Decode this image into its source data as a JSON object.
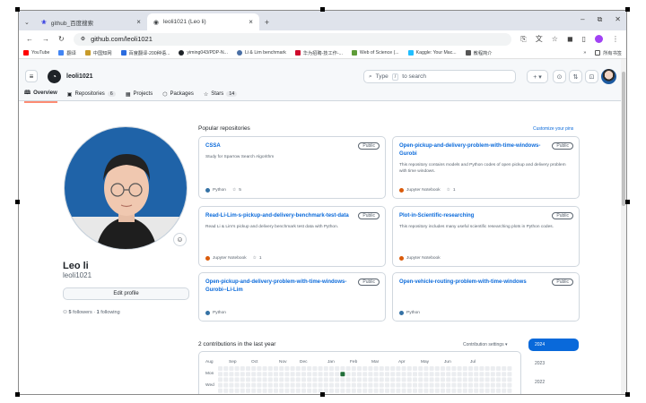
{
  "browser": {
    "tabs": [
      {
        "label": "github_百度搜索",
        "active": false
      },
      {
        "label": "leoli1021 (Leo li)",
        "active": true
      }
    ],
    "url": "github.com/leoli1021",
    "bookmarks": [
      "YouTube",
      "翻译",
      "中国知网",
      "百度翻译-200种语...",
      "yiming043/PDP-N...",
      "Li & Lim benchmark",
      "华为招聘-技工作-...",
      "Web of Science (...",
      "Kaggle: Your Mac...",
      "教程简介"
    ],
    "bookmarks_more": "»",
    "all_bookmarks": "所有书签"
  },
  "header": {
    "username": "leoli1021",
    "search_placeholder": "Type / to search",
    "search_key": "/",
    "search_prefix": "Type",
    "search_suffix": "to search"
  },
  "nav": {
    "overview": "Overview",
    "repositories": "Repositories",
    "repositories_count": "6",
    "projects": "Projects",
    "packages": "Packages",
    "stars": "Stars",
    "stars_count": "14"
  },
  "profile": {
    "name": "Leo li",
    "login": "leoli1021",
    "edit_label": "Edit profile",
    "followers": "5",
    "followers_label": "followers",
    "following": "1",
    "following_label": "following"
  },
  "popular": {
    "title": "Popular repositories",
    "customize": "Customize your pins",
    "repos": [
      {
        "name": "CSSA",
        "badge": "Public",
        "desc": "Study for Sparrow Search Algorithm",
        "lang": "Python",
        "color": "#3572A5",
        "stars": "5"
      },
      {
        "name": "Open-pickup-and-delivery-problem-with-time-windows-Gurobi",
        "badge": "Public",
        "desc": "This repository contains models and Python codes of open pickup and delivery problem with time windows.",
        "lang": "Jupyter Notebook",
        "color": "#DA5B0B",
        "stars": "1"
      },
      {
        "name": "Read-Li-Lim-s-pickup-and-delivery-benchmark-test-data",
        "badge": "Public",
        "desc": "Read Li & Lim's pickup and delivery benchmark test data with Python.",
        "lang": "Jupyter Notebook",
        "color": "#DA5B0B",
        "stars": "1"
      },
      {
        "name": "Plot-in-Scientific-researching",
        "badge": "Public",
        "desc": "This repository includes many useful scientific researching plots in Python codes.",
        "lang": "Jupyter Notebook",
        "color": "#DA5B0B",
        "stars": ""
      },
      {
        "name": "Open-pickup-and-delivery-problem-with-time-windows-Gurobi--Li-Lim",
        "badge": "Public",
        "desc": "",
        "lang": "Python",
        "color": "#3572A5",
        "stars": ""
      },
      {
        "name": "Open-vehicle-routing-problem-with-time-windows",
        "badge": "Public",
        "desc": "",
        "lang": "Python",
        "color": "#3572A5",
        "stars": ""
      }
    ]
  },
  "contributions": {
    "title": "2 contributions in the last year",
    "settings": "Contribution settings ▾",
    "months": [
      "Aug",
      "Sep",
      "Oct",
      "Nov",
      "Dec",
      "Jan",
      "Feb",
      "Mar",
      "Apr",
      "May",
      "Jun",
      "Jul"
    ],
    "days": [
      "Mon",
      "Wed"
    ],
    "years": [
      "2024",
      "2023",
      "2022"
    ],
    "selected_year": "2024"
  },
  "colors": {
    "accent": "#0969da",
    "tab_underline": "#fd8c73",
    "contrib_active": "#216e39"
  }
}
